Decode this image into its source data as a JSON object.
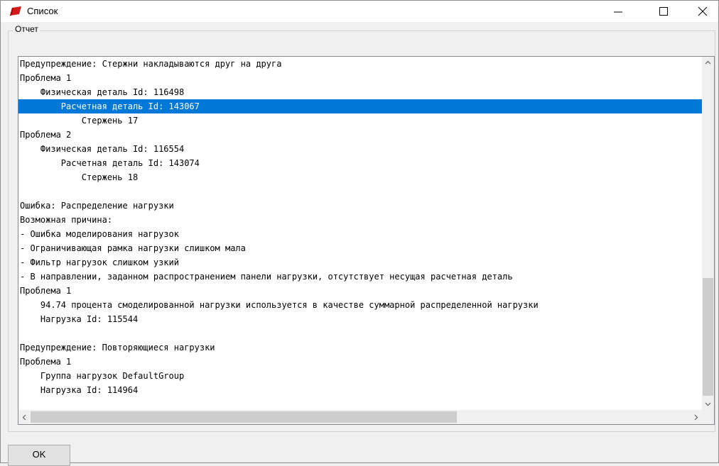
{
  "window": {
    "title": "Список",
    "icon": "red-flag-icon",
    "accent": "#0078d7"
  },
  "group": {
    "label": "Отчет"
  },
  "report_lines": [
    "Предупреждение: Стержни накладываются друг на друга",
    "Проблема 1",
    "    Физическая деталь Id: 116498",
    "        Расчетная деталь Id: 143067",
    "            Стержень 17",
    "Проблема 2",
    "    Физическая деталь Id: 116554",
    "        Расчетная деталь Id: 143074",
    "            Стержень 18",
    "",
    "Ошибка: Распределение нагрузки",
    "Возможная причина:",
    "- Ошибка моделирования нагрузок",
    "- Ограничивающая рамка нагрузки слишком мала",
    "- Фильтр нагрузок слишком узкий",
    "- В направлении, заданном распространением панели нагрузки, отсутствует несущая расчетная деталь",
    "Проблема 1",
    "    94.74 процента смоделированной нагрузки используется в качестве суммарной распределенной нагрузки",
    "    Нагрузка Id: 115544",
    "",
    "Предупреждение: Повторяющиеся нагрузки",
    "Проблема 1",
    "    Группа нагрузок DefaultGroup",
    "    Нагрузка Id: 114964"
  ],
  "selected_index": 3,
  "buttons": {
    "ok_label": "OK"
  }
}
